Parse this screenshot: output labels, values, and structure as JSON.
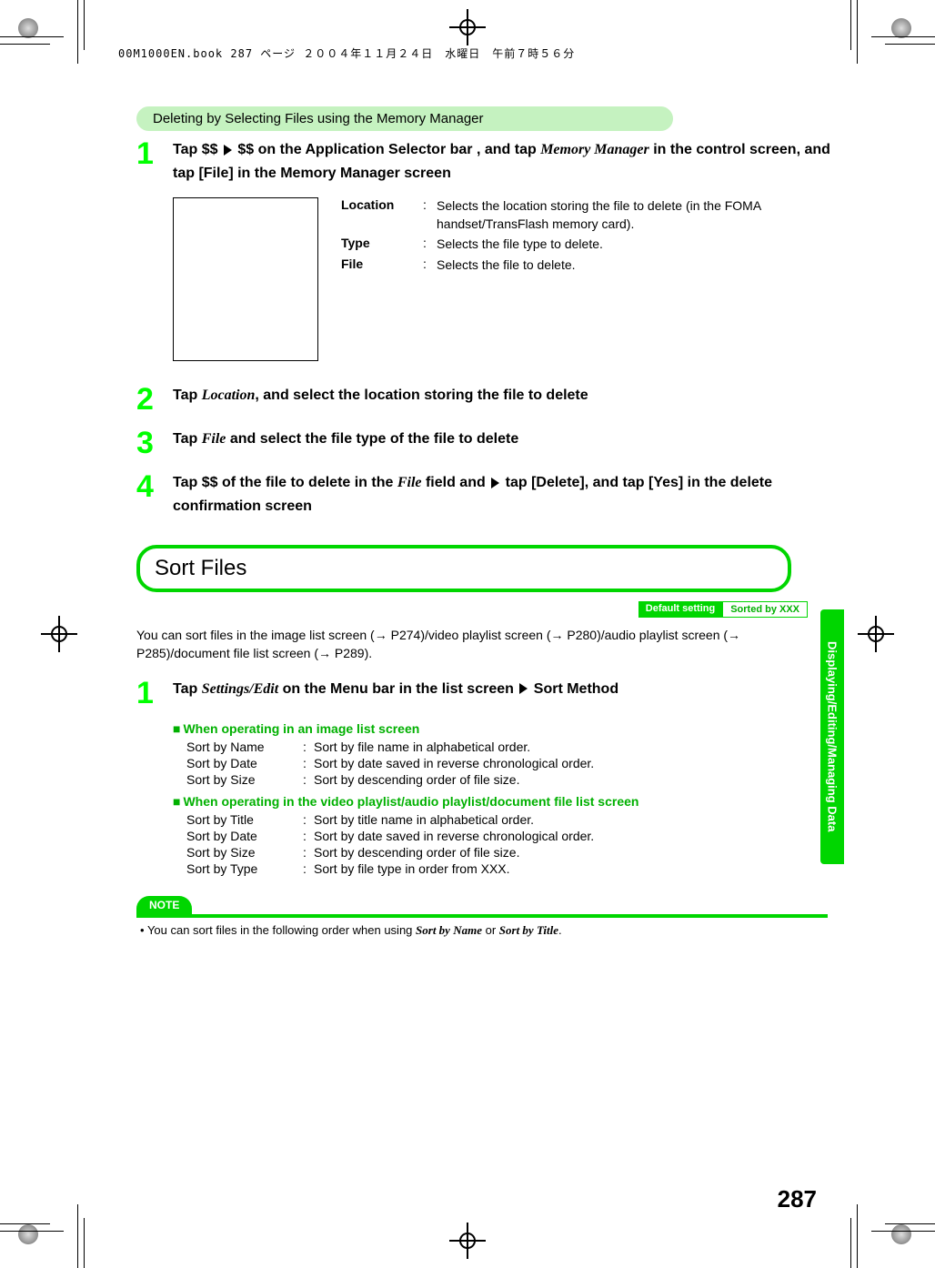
{
  "slug": "00M1000EN.book  287 ページ  ２００４年１１月２４日　水曜日　午前７時５６分",
  "section1": {
    "pill": "Deleting by Selecting Files using the Memory Manager",
    "step1": {
      "num": "1",
      "text_a": "Tap $$ ",
      "text_b": " $$ on the Application Selector bar , and tap ",
      "italic1": "Memory Manager",
      "text_c": " in the control screen, and tap [File] in the Memory Manager screen"
    },
    "table": {
      "r1": {
        "label": "Location",
        "val": "Selects the location storing the file to delete (in the FOMA handset/TransFlash memory card)."
      },
      "r2": {
        "label": "Type",
        "val": "Selects the file type to delete."
      },
      "r3": {
        "label": "File",
        "val": "Selects the file to delete."
      }
    },
    "step2": {
      "num": "2",
      "text_a": "Tap ",
      "italic1": "Location",
      "text_b": ", and select the location storing the file to delete"
    },
    "step3": {
      "num": "3",
      "text_a": "Tap ",
      "italic1": "File",
      "text_b": " and select the file type of the file to delete"
    },
    "step4": {
      "num": "4",
      "text_a": "Tap $$ of the file to delete in the ",
      "italic1": "File",
      "text_b": " field and ",
      "text_c": " tap [Delete], and tap [Yes] in the delete confirmation screen"
    }
  },
  "section2": {
    "heading": "Sort Files",
    "default_label": "Default setting",
    "default_value": "Sorted by XXX",
    "intro_a": "You can sort files in the image list screen (",
    "intro_b": " P274)/video playlist screen (",
    "intro_c": " P280)/audio playlist screen (",
    "intro_d": " P285)/document file list screen (",
    "intro_e": " P289).",
    "step1": {
      "num": "1",
      "text_a": "Tap ",
      "italic1": "Settings/Edit",
      "text_b": " on the Menu bar in the list screen ",
      "text_c": " Sort Method"
    },
    "sub1": {
      "title": "When operating in an image list screen",
      "rows": {
        "r1": {
          "label": "Sort by Name",
          "val": "Sort by file name in alphabetical order."
        },
        "r2": {
          "label": "Sort by Date",
          "val": "Sort by date saved in reverse chronological order."
        },
        "r3": {
          "label": "Sort by Size",
          "val": "Sort by descending order of file size."
        }
      }
    },
    "sub2": {
      "title": "When operating in the video playlist/audio playlist/document file list screen",
      "rows": {
        "r1": {
          "label": "Sort by Title",
          "val": "Sort by title name in alphabetical order."
        },
        "r2": {
          "label": "Sort by Date",
          "val": "Sort by date saved in reverse chronological order."
        },
        "r3": {
          "label": "Sort by Size",
          "val": "Sort by descending order of file size."
        },
        "r4": {
          "label": "Sort by Type",
          "val": "Sort by file type in order from XXX."
        }
      }
    },
    "note": {
      "label": "NOTE",
      "text_a": "You can sort files in the following order when using ",
      "italic1": "Sort by Name",
      "text_b": " or ",
      "italic2": "Sort by Title",
      "text_c": "."
    }
  },
  "sidetab": "Displaying/Editing/Managing Data",
  "pagenum": "287"
}
